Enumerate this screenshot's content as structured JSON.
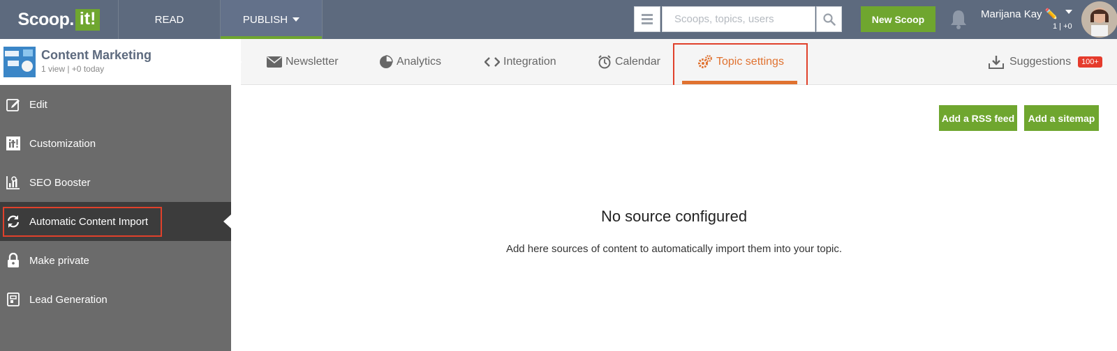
{
  "header": {
    "logo_text": "Scoop.",
    "logo_box": "it!",
    "nav_read": "READ",
    "nav_publish": "PUBLISH",
    "search_placeholder": "Scoops, topics, users",
    "new_scoop_label": "New Scoop",
    "user_name": "Marijana Kay",
    "user_stats": "1 | +0"
  },
  "topic": {
    "title": "Content Marketing",
    "subtitle": "1 view | +0 today"
  },
  "tabs": [
    {
      "label": "Newsletter",
      "icon": "envelope-icon"
    },
    {
      "label": "Analytics",
      "icon": "pie-chart-icon"
    },
    {
      "label": "Integration",
      "icon": "code-icon"
    },
    {
      "label": "Calendar",
      "icon": "alarm-clock-icon"
    },
    {
      "label": "Topic settings",
      "icon": "gears-icon",
      "active": true
    }
  ],
  "suggestions": {
    "label": "Suggestions",
    "badge": "100+"
  },
  "sidebar": {
    "items": [
      {
        "label": "Edit",
        "icon": "edit-icon"
      },
      {
        "label": "Customization",
        "icon": "scoopit-icon"
      },
      {
        "label": "SEO Booster",
        "icon": "seo-chart-icon"
      },
      {
        "label": "Automatic Content Import",
        "icon": "refresh-icon",
        "active": true
      },
      {
        "label": "Make private",
        "icon": "lock-icon"
      },
      {
        "label": "Lead Generation",
        "icon": "form-icon"
      }
    ]
  },
  "main": {
    "add_rss_label": "Add a RSS feed",
    "add_sitemap_label": "Add a sitemap",
    "empty_title": "No source configured",
    "empty_desc": "Add here sources of content to automatically import them into your topic."
  },
  "colors": {
    "topbar": "#5d6a7e",
    "green": "#6fa62f",
    "orange_active": "#e07230",
    "sidebar_bg": "#6b6b6b",
    "sidebar_active": "#3c3c3c",
    "highlight_red": "#e0412b",
    "badge_red": "#e53b2c"
  }
}
